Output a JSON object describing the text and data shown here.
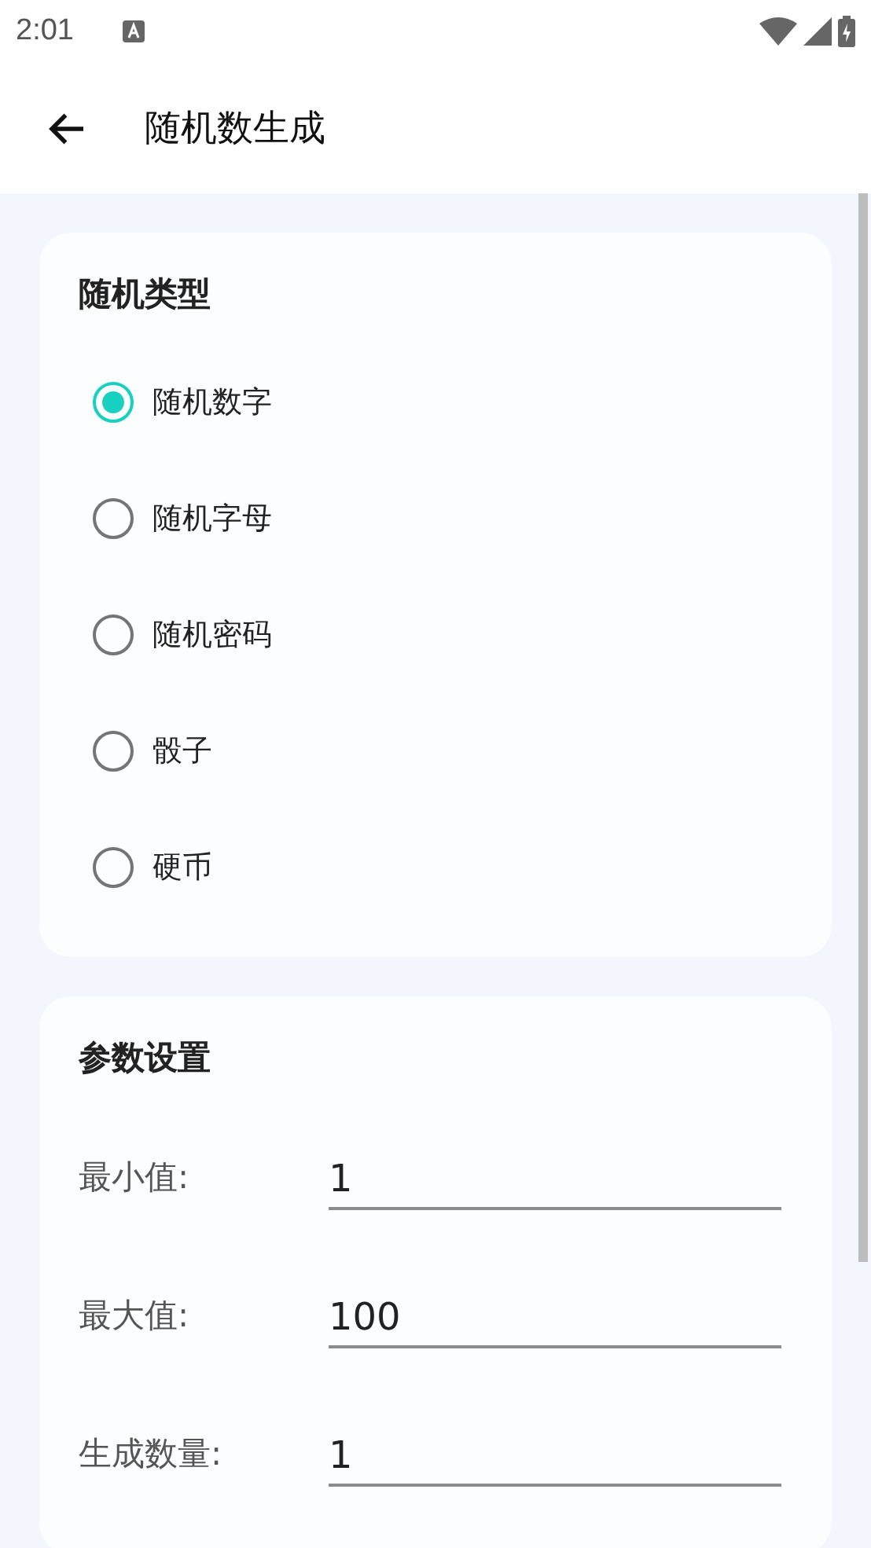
{
  "status_bar": {
    "time": "2:01"
  },
  "app_bar": {
    "title": "随机数生成"
  },
  "random_type": {
    "title": "随机类型",
    "options": [
      {
        "label": "随机数字",
        "selected": true
      },
      {
        "label": "随机字母",
        "selected": false
      },
      {
        "label": "随机密码",
        "selected": false
      },
      {
        "label": "骰子",
        "selected": false
      },
      {
        "label": "硬币",
        "selected": false
      }
    ]
  },
  "parameters": {
    "title": "参数设置",
    "fields": [
      {
        "label": "最小值:",
        "value": "1"
      },
      {
        "label": "最大值:",
        "value": "100"
      },
      {
        "label": "生成数量:",
        "value": "1"
      }
    ]
  }
}
